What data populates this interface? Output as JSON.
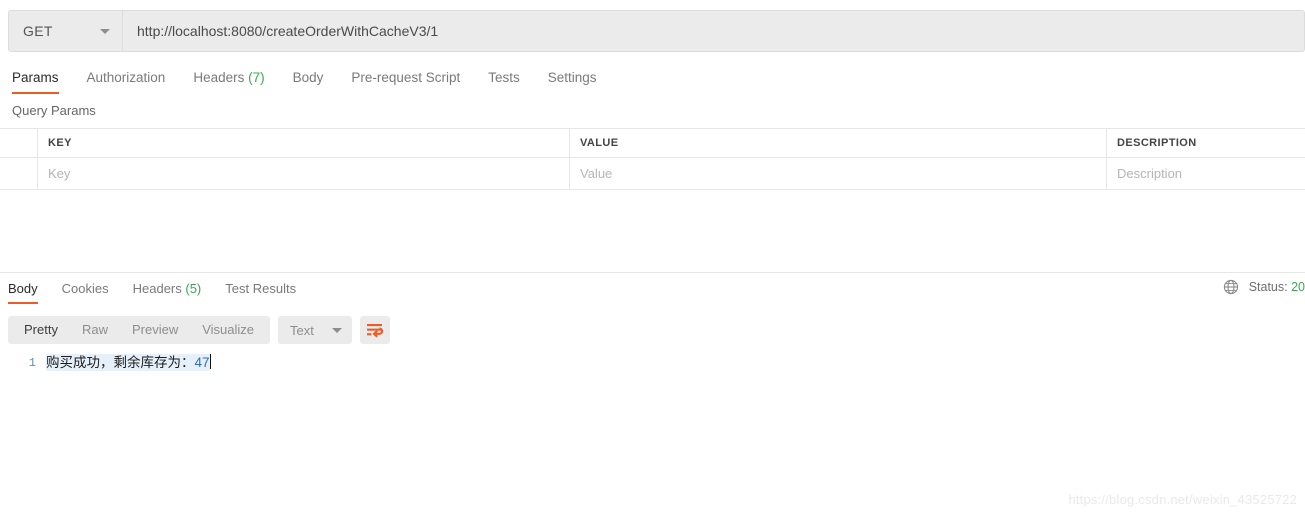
{
  "request": {
    "method": "GET",
    "url": "http://localhost:8080/createOrderWithCacheV3/1",
    "tabs": [
      {
        "label": "Params",
        "count": "",
        "active": true
      },
      {
        "label": "Authorization",
        "count": "",
        "active": false
      },
      {
        "label": "Headers",
        "count": "(7)",
        "active": false
      },
      {
        "label": "Body",
        "count": "",
        "active": false
      },
      {
        "label": "Pre-request Script",
        "count": "",
        "active": false
      },
      {
        "label": "Tests",
        "count": "",
        "active": false
      },
      {
        "label": "Settings",
        "count": "",
        "active": false
      }
    ],
    "query_params": {
      "section_title": "Query Params",
      "columns": [
        "KEY",
        "VALUE",
        "DESCRIPTION"
      ],
      "empty_row": {
        "key_placeholder": "Key",
        "value_placeholder": "Value",
        "description_placeholder": "Description"
      }
    }
  },
  "response": {
    "tabs": [
      {
        "label": "Body",
        "count": "",
        "active": true
      },
      {
        "label": "Cookies",
        "count": "",
        "active": false
      },
      {
        "label": "Headers",
        "count": "(5)",
        "active": false
      },
      {
        "label": "Test Results",
        "count": "",
        "active": false
      }
    ],
    "status_label": "Status:",
    "status_code": "20",
    "globe_icon": "globe-icon",
    "view_modes": [
      {
        "label": "Pretty",
        "active": true
      },
      {
        "label": "Raw",
        "active": false
      },
      {
        "label": "Preview",
        "active": false
      },
      {
        "label": "Visualize",
        "active": false
      }
    ],
    "format": "Text",
    "wrap_icon": "word-wrap-icon",
    "body": {
      "line_number": "1",
      "text_prefix": "购买成功，剩余库存为：",
      "text_number": "47"
    }
  },
  "watermark": "https://blog.csdn.net/weixin_43525722",
  "colors": {
    "accent": "#ef5b25",
    "count_green": "#3aa757",
    "control_bg": "#ebebeb",
    "border": "#e6e6e6"
  }
}
